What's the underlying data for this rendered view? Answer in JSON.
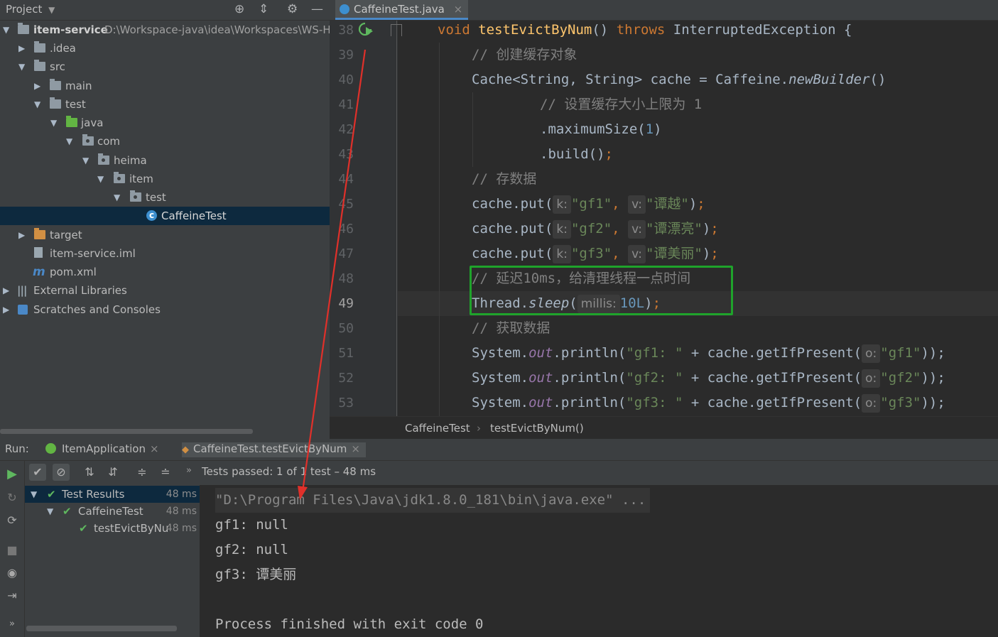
{
  "project_panel": {
    "title": "Project",
    "tree": [
      {
        "label": "item-service",
        "extra": "D:\\Workspace-java\\idea\\Workspaces\\WS-HM",
        "arrow": "▼",
        "icon": "module-folder"
      },
      {
        "label": ".idea",
        "arrow": "▶",
        "icon": "folder"
      },
      {
        "label": "src",
        "arrow": "▼",
        "icon": "folder"
      },
      {
        "label": "main",
        "arrow": "▶",
        "icon": "folder"
      },
      {
        "label": "test",
        "arrow": "▼",
        "icon": "folder"
      },
      {
        "label": "java",
        "arrow": "▼",
        "icon": "test-source-folder"
      },
      {
        "label": "com",
        "arrow": "▼",
        "icon": "package"
      },
      {
        "label": "heima",
        "arrow": "▼",
        "icon": "package"
      },
      {
        "label": "item",
        "arrow": "▼",
        "icon": "package"
      },
      {
        "label": "test",
        "arrow": "▼",
        "icon": "package"
      },
      {
        "label": "CaffeineTest",
        "arrow": "",
        "icon": "class-file"
      },
      {
        "label": "target",
        "arrow": "▶",
        "icon": "excluded-folder"
      },
      {
        "label": "item-service.iml",
        "arrow": "",
        "icon": "iml-file"
      },
      {
        "label": "pom.xml",
        "arrow": "",
        "icon": "maven-file"
      },
      {
        "label": "External Libraries",
        "arrow": "▶",
        "icon": "libraries"
      },
      {
        "label": "Scratches and Consoles",
        "arrow": "▶",
        "icon": "scratches"
      }
    ]
  },
  "editor": {
    "tab": {
      "label": "CaffeineTest.java",
      "close": "×"
    },
    "line_numbers": [
      "38",
      "39",
      "40",
      "41",
      "42",
      "43",
      "44",
      "45",
      "46",
      "47",
      "48",
      "49",
      "50",
      "51",
      "52",
      "53"
    ],
    "current_line": "49",
    "code": {
      "l38": {
        "kw": "void ",
        "fn": "testEvictByNum",
        "p": "() ",
        "kw2": "throws ",
        "t": "InterruptedException {"
      },
      "l39": "// 创建缓存对象",
      "l40a": "Cache<String, String> cache = Caffeine.",
      "l40b": "newBuilder",
      "l40c": "()",
      "l41": "// 设置缓存大小上限为 1",
      "l42a": ".maximumSize(",
      "l42b": "1",
      "l42c": ")",
      "l43a": ".build()",
      "l43b": ";",
      "l44": "// 存数据",
      "put_prefix": "cache.put(",
      "hint_k": "k:",
      "hint_v": "v:",
      "comma": ",",
      "close_paren": ")",
      "semi": ";",
      "puts": [
        {
          "k": "\"gf1\"",
          "v": "\"谭越\""
        },
        {
          "k": "\"gf2\"",
          "v": "\"谭漂亮\""
        },
        {
          "k": "\"gf3\"",
          "v": "\"谭美丽\""
        }
      ],
      "l48": "// 延迟10ms，给清理线程一点时间",
      "l49a": "Thread.",
      "l49b": "sleep",
      "l49c": "(",
      "l49hint": "millis:",
      "l49num": "10L",
      "l49d": ")",
      "l50": "// 获取数据",
      "print_a": "System.",
      "print_out": "out",
      "print_b": ".println(",
      "print_plus": " + cache.getIfPresent(",
      "hint_o": "o:",
      "print_end": "));",
      "prints": [
        {
          "label": "\"gf1: \"",
          "key": "\"gf1\""
        },
        {
          "label": "\"gf2: \"",
          "key": "\"gf2\""
        },
        {
          "label": "\"gf3: \"",
          "key": "\"gf3\""
        }
      ]
    },
    "breadcrumb": [
      "CaffeineTest",
      "testEvictByNum()"
    ],
    "breadcrumb_sep": "›"
  },
  "run_panel": {
    "label": "Run:",
    "tabs": [
      {
        "label": "ItemApplication",
        "close": "×"
      },
      {
        "label": "CaffeineTest.testEvictByNum",
        "close": "×"
      }
    ],
    "status": "Tests passed: 1 of 1 test – 48 ms",
    "more": "»",
    "test_tree": [
      {
        "label": "Test Results",
        "duration": "48 ms"
      },
      {
        "label": "CaffeineTest",
        "duration": "48 ms"
      },
      {
        "label": "testEvictByNu",
        "duration": "48 ms"
      }
    ],
    "console": [
      "\"D:\\Program Files\\Java\\jdk1.8.0_181\\bin\\java.exe\" ...",
      "gf1: null",
      "gf2: null",
      "gf3: 谭美丽",
      "",
      "Process finished with exit code 0"
    ]
  },
  "colors": {
    "keyword": "#cc7832",
    "string": "#6a8759",
    "comment": "#808080",
    "highlight_box": "#1fa32b",
    "annotation_arrow": "#e0302a",
    "selection": "#0d293e"
  }
}
